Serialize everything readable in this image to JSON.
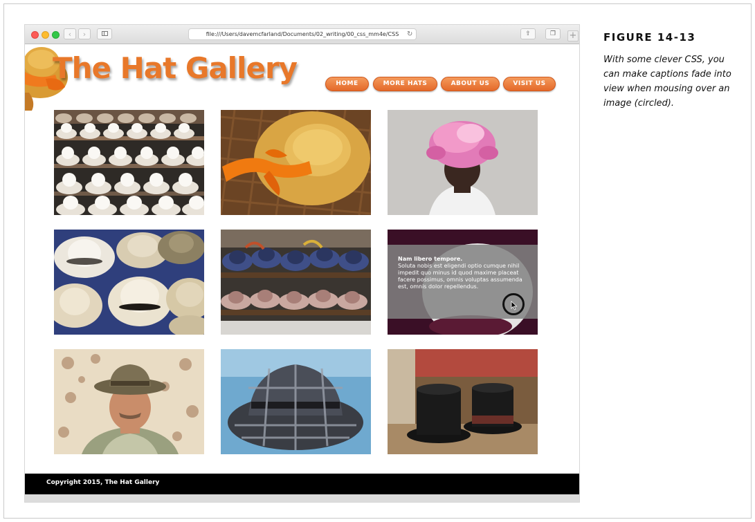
{
  "figure": {
    "label": "FIGURE 14-13",
    "caption": "With some clever CSS, you can make captions fade into view when mousing over an image (circled)."
  },
  "browser": {
    "url": "file:///Users/davemcfarland/Documents/02_writing/00_css_mm4e/CSS",
    "back_icon": "chevron-left-icon",
    "forward_icon": "chevron-right-icon"
  },
  "site": {
    "title": "The Hat Gallery",
    "nav": [
      "HOME",
      "MORE HATS",
      "ABOUT US",
      "VISIT US"
    ],
    "accent_color": "#e8782a",
    "footer": "Copyright 2015, The Hat Gallery"
  },
  "gallery": {
    "hover_caption": {
      "title": "Nam libero tempore.",
      "text": "Soluta nobis est eligendi optio cumque nihil impedit quo minus id quod maxime placeat facere possimus, omnis voluptas assumenda est, omnis dolor repellendus."
    }
  }
}
